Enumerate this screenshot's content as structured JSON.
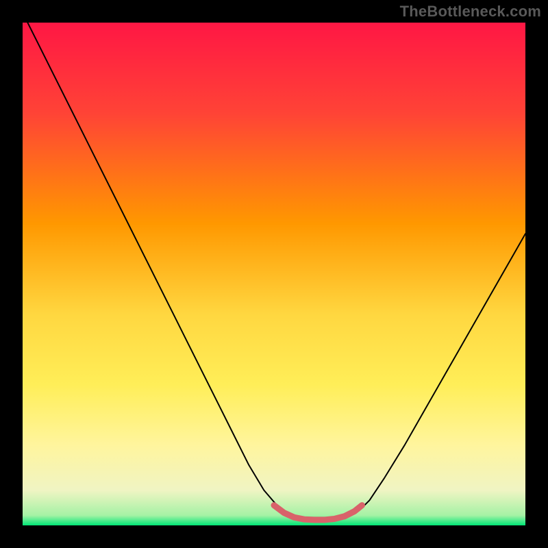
{
  "watermark": "TheBottleneck.com",
  "chart_data": {
    "type": "line",
    "title": "",
    "xlabel": "",
    "ylabel": "",
    "xlim": [
      0,
      100
    ],
    "ylim": [
      0,
      100
    ],
    "gradient_stops": [
      {
        "offset": 0,
        "color": "#ff1744"
      },
      {
        "offset": 18,
        "color": "#ff4336"
      },
      {
        "offset": 40,
        "color": "#ff9800"
      },
      {
        "offset": 58,
        "color": "#ffd740"
      },
      {
        "offset": 72,
        "color": "#ffee58"
      },
      {
        "offset": 84,
        "color": "#fff59d"
      },
      {
        "offset": 93,
        "color": "#f0f4c3"
      },
      {
        "offset": 98,
        "color": "#a5f2a5"
      },
      {
        "offset": 100,
        "color": "#00e676"
      }
    ],
    "series": [
      {
        "name": "curve",
        "color": "#000000",
        "width": 2,
        "x": [
          0.0,
          3,
          6,
          9,
          12,
          15,
          18,
          21,
          24,
          27,
          30,
          33,
          36,
          39,
          42,
          45,
          48,
          51,
          53,
          55,
          57,
          59,
          61,
          63,
          65,
          67,
          69,
          72,
          76,
          80,
          84,
          88,
          92,
          96,
          100
        ],
        "y": [
          102,
          96,
          90,
          84,
          78,
          72,
          66,
          60,
          54,
          48,
          42,
          36,
          30,
          24,
          18,
          12,
          7,
          3.5,
          2,
          1.3,
          1.0,
          1.0,
          1.0,
          1.2,
          1.8,
          3.0,
          5.0,
          9.5,
          16,
          23,
          30,
          37,
          44,
          51,
          58
        ]
      },
      {
        "name": "marker-band",
        "color": "#d9626a",
        "width": 9,
        "x": [
          50,
          52,
          54,
          56,
          58,
          60,
          62,
          64,
          66,
          67.5
        ],
        "y": [
          4.0,
          2.5,
          1.6,
          1.2,
          1.1,
          1.1,
          1.3,
          1.8,
          2.8,
          4.0
        ]
      }
    ]
  }
}
